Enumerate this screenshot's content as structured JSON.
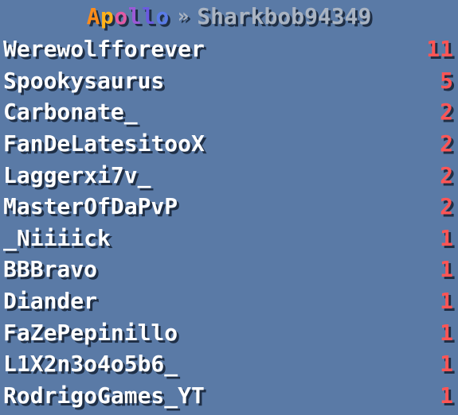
{
  "scoreboard": {
    "header": {
      "server": "Apollo",
      "separator": "»",
      "player": "Sharkbob94349"
    },
    "header_colors": [
      "#ff8c1a",
      "#ffb21a",
      "#e05aa5",
      "#9b59d6",
      "#6a5ae0",
      "#5a7be8"
    ],
    "colors": {
      "background": "#5a7aa6",
      "name": "#ffffff",
      "score": "#ff5555",
      "muted": "#aab4c2"
    },
    "rows": [
      {
        "name": "Werewolfforever",
        "score": "11"
      },
      {
        "name": "Spookysaurus",
        "score": "5"
      },
      {
        "name": "Carbonate_",
        "score": "2"
      },
      {
        "name": "FanDeLatesitooX",
        "score": "2"
      },
      {
        "name": "Laggerxi7v_",
        "score": "2"
      },
      {
        "name": "MasterOfDaPvP",
        "score": "2"
      },
      {
        "name": "_Niiiick",
        "score": "1"
      },
      {
        "name": "BBBravo",
        "score": "1"
      },
      {
        "name": "Diander",
        "score": "1"
      },
      {
        "name": "FaZePepinillo",
        "score": "1"
      },
      {
        "name": "L1X2n3o4o5b6_",
        "score": "1"
      },
      {
        "name": "RodrigoGames_YT",
        "score": "1"
      }
    ]
  }
}
